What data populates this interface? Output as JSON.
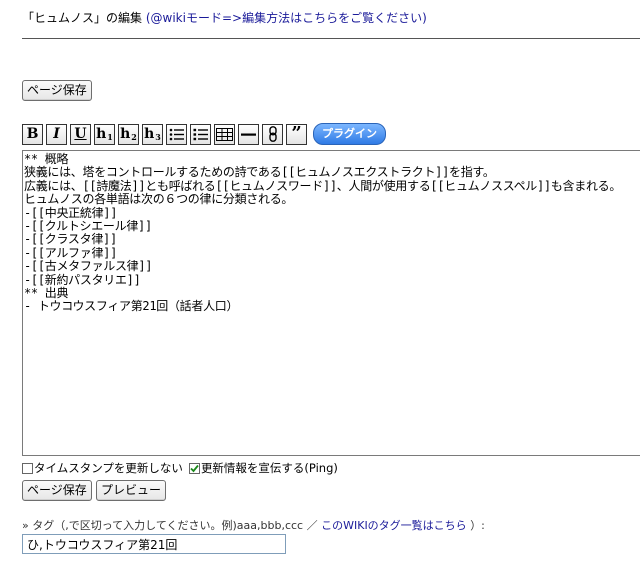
{
  "header": {
    "title": "「ヒュムノス」の編集",
    "mode_link": "(@wikiモード=>編集方法はこちらをご覧ください)"
  },
  "buttons": {
    "save_top": "ページ保存",
    "save_bottom": "ページ保存",
    "preview": "プレビュー"
  },
  "toolbar": {
    "plugin": "プラグイン"
  },
  "editor": {
    "content": "** 概略\n狭義には、塔をコントロールするための詩である[[ヒュムノスエクストラクト]]を指す。\n広義には、[[詩魔法]]とも呼ばれる[[ヒュムノスワード]]、人間が使用する[[ヒュムノススペル]]も含まれる。\nヒュムノスの各単語は次の６つの律に分類される。\n-[[中央正統律]]\n-[[クルトシエール律]]\n-[[クラスタ律]]\n-[[アルファ律]]\n-[[古メタファルス律]]\n-[[新約パスタリエ]]\n** 出典\n- トウコウスフィア第21回（話者人口）"
  },
  "options": {
    "timestamp_label": "タイムスタンプを更新しない",
    "timestamp_checked": false,
    "ping_label": "更新情報を宣伝する(Ping)",
    "ping_checked": true
  },
  "tags": {
    "label": "» タグ（,で区切って入力してください。例)aaa,bbb,ccc ／",
    "link": "このWIKIのタグ一覧はこちら",
    "label_end": "）:",
    "value": "ひ,トウコウスフィア第21回"
  },
  "colors": {
    "link": "#1a1a99",
    "plugin_bg": "#2f7ae5",
    "check": "#1a8a1a"
  }
}
